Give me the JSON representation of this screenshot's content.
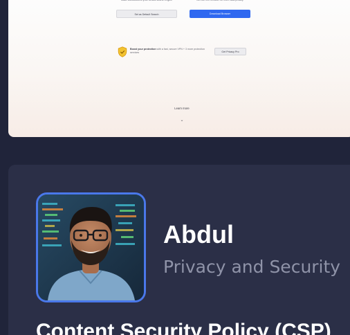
{
  "preview": {
    "left_col": {
      "text": "Make DuckDuckGo your default search engine",
      "button": "Set as Default Search"
    },
    "right_col": {
      "text": "Get our free browser for more data privacy",
      "button": "Download Browser"
    },
    "vpn": {
      "title": "Boost your protection",
      "text": "with a fast, secure VPN + 3 more protection services",
      "button": "Get Privacy Pro"
    },
    "learn_more": "Learn more",
    "colors": {
      "primary_button": "#2f68f0",
      "shield": "#f2c230"
    }
  },
  "author": {
    "name": "Abdul",
    "role": "Privacy and Security",
    "avatar_icon": "author-photo"
  },
  "article": {
    "heading": "Content Security Policy (CSP)"
  },
  "theme": {
    "background": "#20243a",
    "card": "#2b2f47",
    "accent": "#4a78ea",
    "muted_text": "#8f93a8"
  }
}
